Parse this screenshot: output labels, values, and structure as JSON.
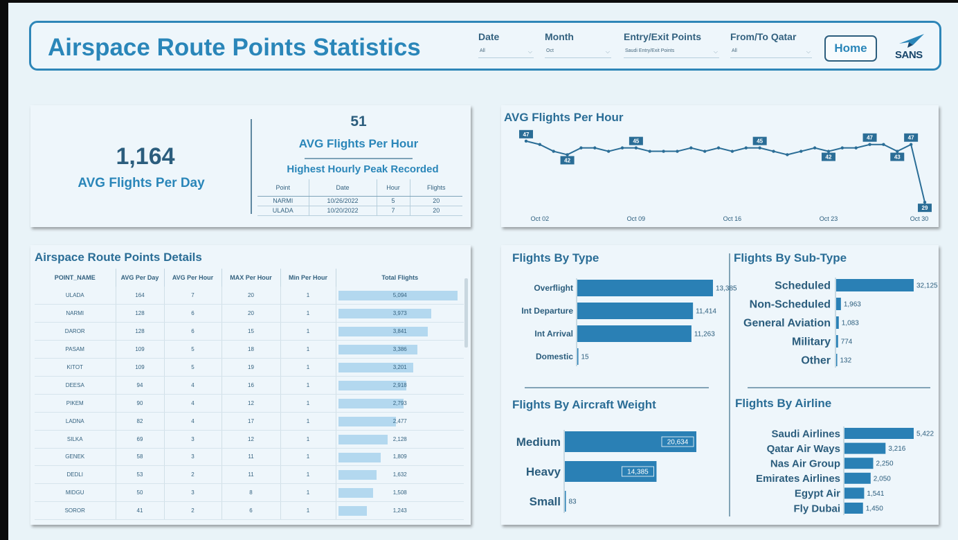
{
  "header": {
    "title": "Airspace Route Points Statistics",
    "filters": [
      {
        "label": "Date",
        "value": "All"
      },
      {
        "label": "Month",
        "value": "Oct"
      },
      {
        "label": "Entry/Exit Points",
        "value": "Saudi Entry/Exit Points"
      },
      {
        "label": "From/To Qatar",
        "value": "All"
      }
    ],
    "home_label": "Home",
    "logo_text": "SANS"
  },
  "kpi": {
    "avg_per_day_value": "1,164",
    "avg_per_day_label": "AVG Flights Per Day",
    "avg_per_hour_value": "51",
    "avg_per_hour_label": "AVG Flights Per Hour",
    "peak_title": "Highest Hourly Peak Recorded",
    "peak_columns": [
      "Point",
      "Date",
      "Hour",
      "Flights"
    ],
    "peak_rows": [
      [
        "NARMI",
        "10/26/2022",
        "5",
        "20"
      ],
      [
        "ULADA",
        "10/20/2022",
        "7",
        "20"
      ]
    ]
  },
  "colors": {
    "accent": "#2a86b9",
    "bar": "#2a80b5",
    "bar_light": "#b3d8ef",
    "title_text": "#2a6d96"
  },
  "line_chart": {
    "title": "AVG Flights Per Hour",
    "chart_data": {
      "type": "line",
      "x": [
        "Oct 01",
        "Oct 02",
        "Oct 03",
        "Oct 04",
        "Oct 05",
        "Oct 06",
        "Oct 07",
        "Oct 08",
        "Oct 09",
        "Oct 10",
        "Oct 11",
        "Oct 12",
        "Oct 13",
        "Oct 14",
        "Oct 15",
        "Oct 16",
        "Oct 17",
        "Oct 18",
        "Oct 19",
        "Oct 20",
        "Oct 21",
        "Oct 22",
        "Oct 23",
        "Oct 24",
        "Oct 25",
        "Oct 26",
        "Oct 27",
        "Oct 28",
        "Oct 29",
        "Oct 30"
      ],
      "y": [
        47,
        46,
        44,
        43,
        45,
        45,
        44,
        45,
        45,
        44,
        44,
        44,
        45,
        44,
        45,
        44,
        45,
        45,
        44,
        43,
        44,
        45,
        44,
        45,
        45,
        46,
        46,
        44,
        46,
        29
      ],
      "labeled_points": [
        {
          "index": 0,
          "label": "47"
        },
        {
          "index": 3,
          "label": "42"
        },
        {
          "index": 8,
          "label": "45"
        },
        {
          "index": 17,
          "label": "45"
        },
        {
          "index": 22,
          "label": "42"
        },
        {
          "index": 25,
          "label": "47"
        },
        {
          "index": 27,
          "label": "43"
        },
        {
          "index": 28,
          "label": "47"
        },
        {
          "index": 29,
          "label": "29"
        }
      ],
      "x_ticks": [
        {
          "index": 1,
          "label": "Oct 02"
        },
        {
          "index": 8,
          "label": "Oct 09"
        },
        {
          "index": 15,
          "label": "Oct 16"
        },
        {
          "index": 22,
          "label": "Oct 23"
        },
        {
          "index": 29,
          "label": "Oct 30"
        }
      ],
      "ylim": [
        27,
        49
      ]
    }
  },
  "details": {
    "title": "Airspace Route Points Details",
    "columns": [
      "POINT_NAME",
      "AVG Per Day",
      "AVG Per Hour",
      "MAX Per Hour",
      "Min Per Hour",
      "Total Flights"
    ],
    "rows": [
      {
        "name": "ULADA",
        "day": "164",
        "hour": "7",
        "max": "20",
        "min": "1",
        "total": "5,094",
        "total_num": 5094
      },
      {
        "name": "NARMI",
        "day": "128",
        "hour": "6",
        "max": "20",
        "min": "1",
        "total": "3,973",
        "total_num": 3973
      },
      {
        "name": "DAROR",
        "day": "128",
        "hour": "6",
        "max": "15",
        "min": "1",
        "total": "3,841",
        "total_num": 3841
      },
      {
        "name": "PASAM",
        "day": "109",
        "hour": "5",
        "max": "18",
        "min": "1",
        "total": "3,386",
        "total_num": 3386
      },
      {
        "name": "KITOT",
        "day": "109",
        "hour": "5",
        "max": "19",
        "min": "1",
        "total": "3,201",
        "total_num": 3201
      },
      {
        "name": "DEESA",
        "day": "94",
        "hour": "4",
        "max": "16",
        "min": "1",
        "total": "2,918",
        "total_num": 2918
      },
      {
        "name": "PIKEM",
        "day": "90",
        "hour": "4",
        "max": "12",
        "min": "1",
        "total": "2,793",
        "total_num": 2793
      },
      {
        "name": "LADNA",
        "day": "82",
        "hour": "4",
        "max": "17",
        "min": "1",
        "total": "2,477",
        "total_num": 2477
      },
      {
        "name": "SILKA",
        "day": "69",
        "hour": "3",
        "max": "12",
        "min": "1",
        "total": "2,128",
        "total_num": 2128
      },
      {
        "name": "GENEK",
        "day": "58",
        "hour": "3",
        "max": "11",
        "min": "1",
        "total": "1,809",
        "total_num": 1809
      },
      {
        "name": "DEDLI",
        "day": "53",
        "hour": "2",
        "max": "11",
        "min": "1",
        "total": "1,632",
        "total_num": 1632
      },
      {
        "name": "MIDGU",
        "day": "50",
        "hour": "3",
        "max": "8",
        "min": "1",
        "total": "1,508",
        "total_num": 1508
      },
      {
        "name": "SOROR",
        "day": "41",
        "hour": "2",
        "max": "6",
        "min": "1",
        "total": "1,243",
        "total_num": 1243
      }
    ]
  },
  "bar_charts": [
    {
      "id": "by-type",
      "title": "Flights By Type",
      "chart_data": {
        "type": "bar",
        "orientation": "horizontal",
        "categories": [
          "Overflight",
          "Int Departure",
          "Int Arrival",
          "Domestic"
        ],
        "values": [
          13385,
          11414,
          11263,
          15
        ],
        "labels": [
          "13,385",
          "11,414",
          "11,263",
          "15"
        ]
      }
    },
    {
      "id": "by-subtype",
      "title": "Flights By Sub-Type",
      "chart_data": {
        "type": "bar",
        "orientation": "horizontal",
        "categories": [
          "Scheduled",
          "Non-Scheduled",
          "General Aviation",
          "Military",
          "Other"
        ],
        "values": [
          32125,
          1963,
          1083,
          774,
          132
        ],
        "labels": [
          "32,125",
          "1,963",
          "1,083",
          "774",
          "132"
        ]
      }
    },
    {
      "id": "by-weight",
      "title": "Flights By Aircraft Weight",
      "chart_data": {
        "type": "bar",
        "orientation": "horizontal",
        "categories": [
          "Medium",
          "Heavy",
          "Small"
        ],
        "values": [
          20634,
          14385,
          83
        ],
        "labels": [
          "20,634",
          "14,385",
          "83"
        ]
      }
    },
    {
      "id": "by-airline",
      "title": "Flights By Airline",
      "chart_data": {
        "type": "bar",
        "orientation": "horizontal",
        "categories": [
          "Saudi Airlines",
          "Qatar Air Ways",
          "Nas Air Group",
          "Emirates Airlines",
          "Egypt Air",
          "Fly Dubai"
        ],
        "values": [
          5422,
          3216,
          2250,
          2050,
          1541,
          1450
        ],
        "labels": [
          "5,422",
          "3,216",
          "2,250",
          "2,050",
          "1,541",
          "1,450"
        ]
      }
    }
  ]
}
